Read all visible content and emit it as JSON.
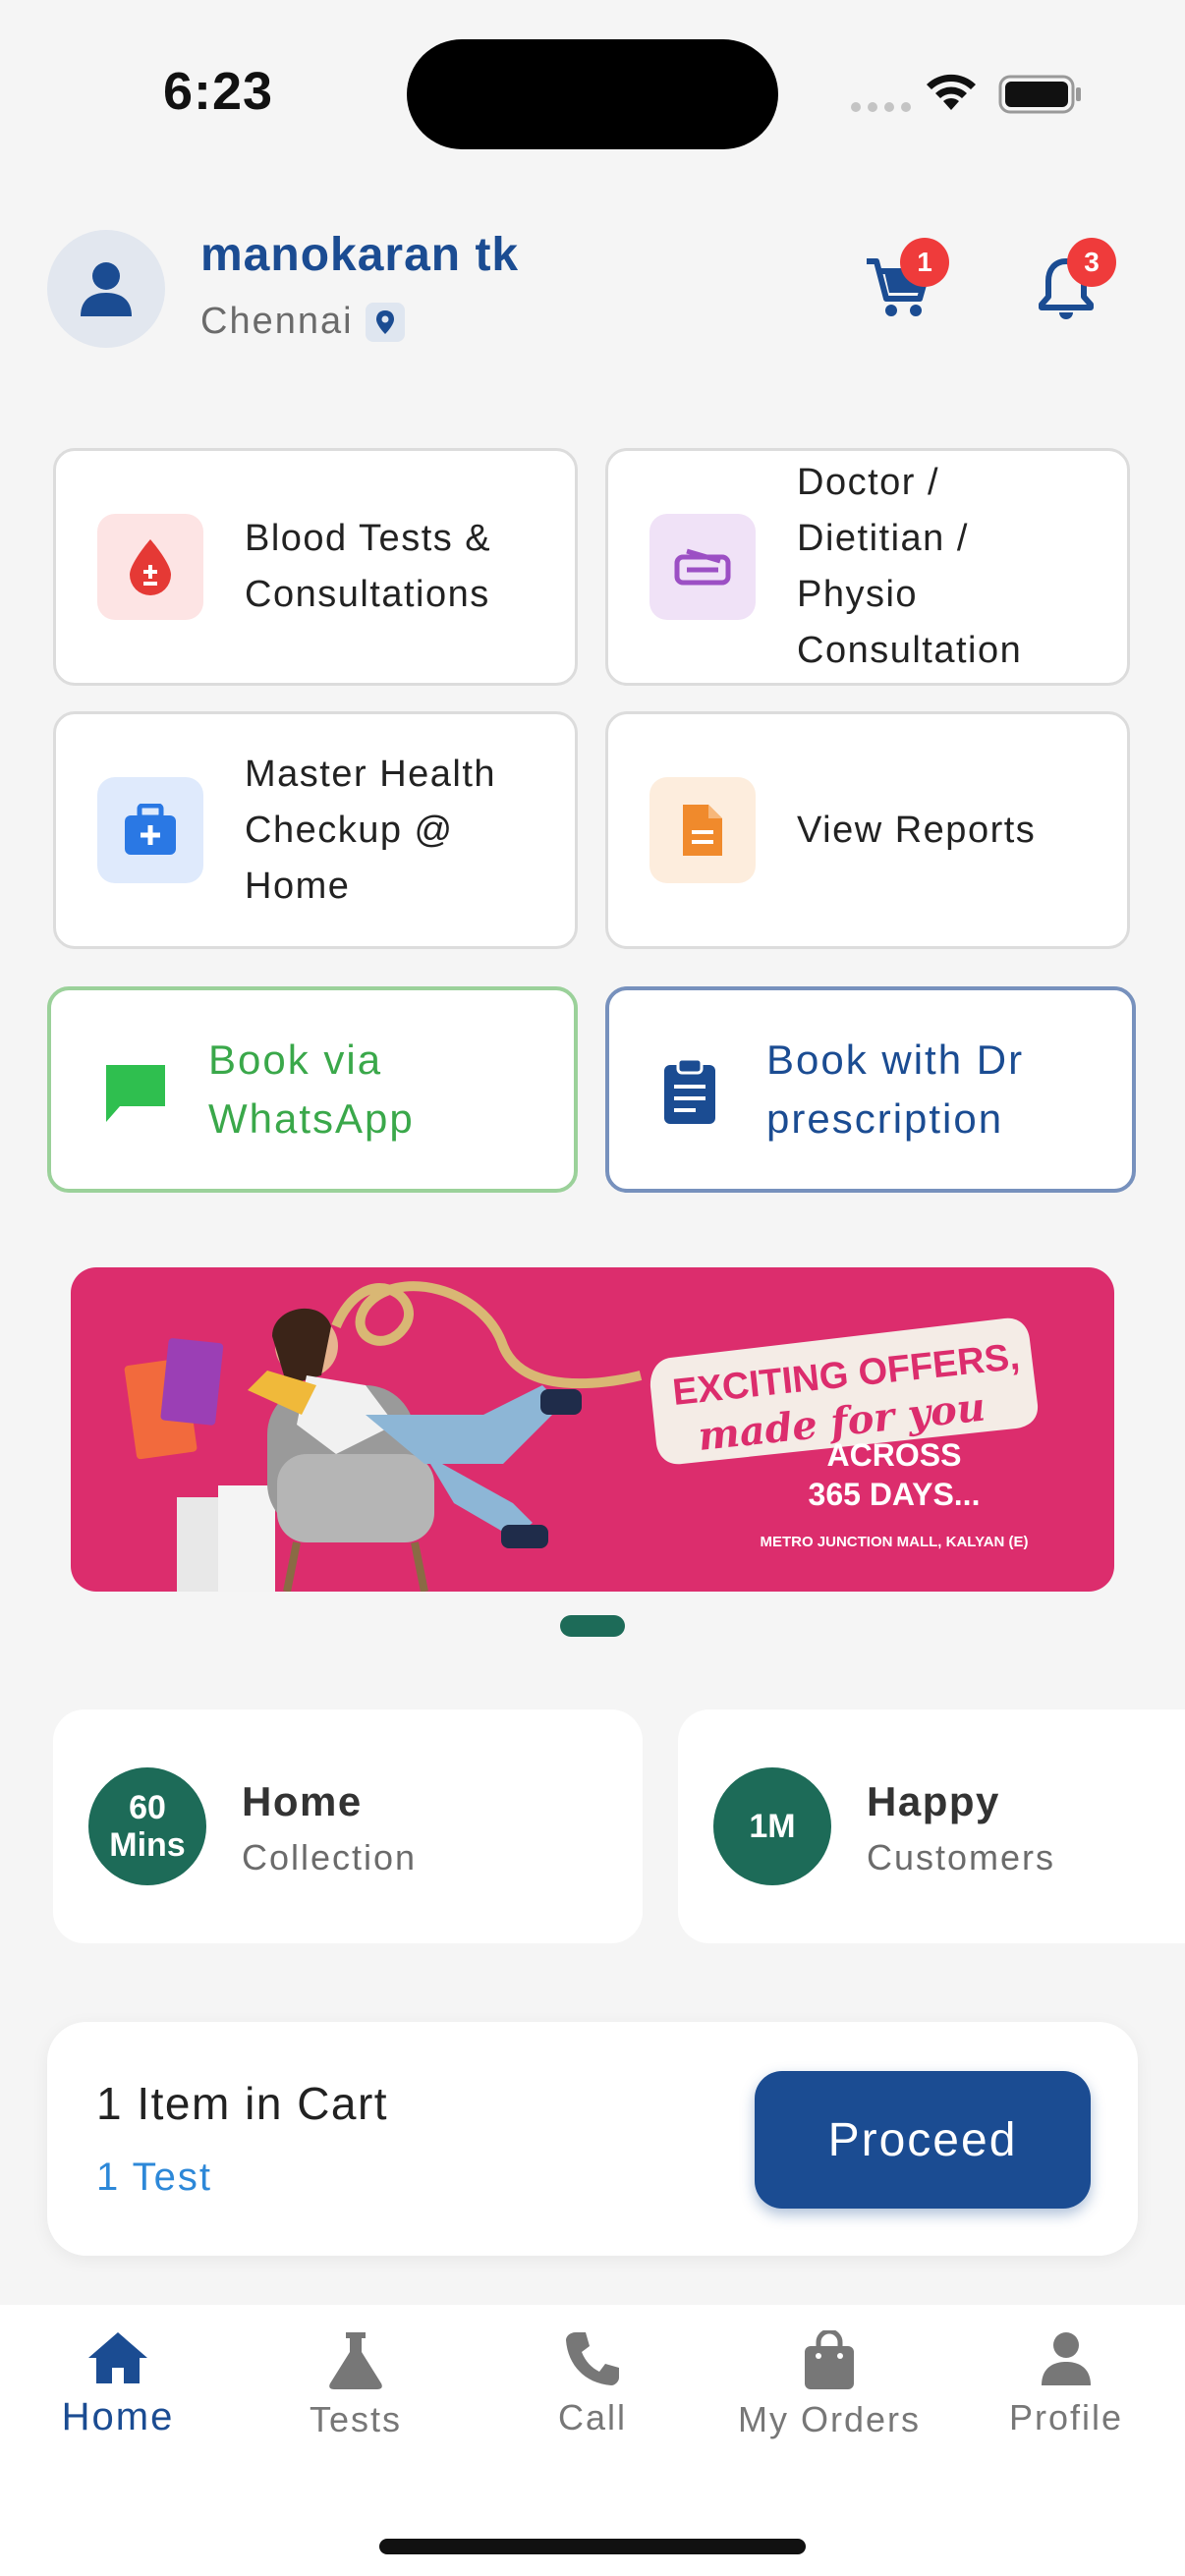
{
  "status_bar": {
    "time": "6:23"
  },
  "header": {
    "user_name": "manokaran tk",
    "city": "Chennai",
    "cart_count": "1",
    "notification_count": "3"
  },
  "services": [
    {
      "label": "Blood Tests &\nConsultations",
      "icon": "blood-drop-icon",
      "color": "#e53935",
      "bg": "#fde4e4"
    },
    {
      "label": "Doctor /\nDietitian /\nPhysio\nConsultation",
      "icon": "stethoscope-icon",
      "color": "#9c4fc4",
      "bg": "#f0e2f7"
    },
    {
      "label": "Master Health\nCheckup @\nHome",
      "icon": "medical-kit-icon",
      "color": "#2a78e4",
      "bg": "#dfeafc"
    },
    {
      "label": "View Reports",
      "icon": "document-icon",
      "color": "#f08a2c",
      "bg": "#fdeddd"
    }
  ],
  "booking": {
    "whatsapp_label": "Book via\nWhatsApp",
    "prescription_label": "Book with Dr\nprescription",
    "whatsapp_color": "#3aa84a",
    "prescription_color": "#1b4c92"
  },
  "banner": {
    "line1": "EXCITING OFFERS,",
    "line2": "made for you",
    "line3": "ACROSS",
    "line4": "365 DAYS...",
    "line5": "METRO JUNCTION MALL, KALYAN (E)"
  },
  "stats": [
    {
      "badge_line1": "60",
      "badge_line2": "Mins",
      "title": "Home",
      "subtitle": "Collection"
    },
    {
      "badge_line1": "1M",
      "badge_line2": "",
      "title": "Happy",
      "subtitle": "Customers"
    }
  ],
  "cart_summary": {
    "title": "1 Item in Cart",
    "subtitle": "1 Test",
    "button": "Proceed"
  },
  "nav": [
    {
      "label": "Home",
      "icon": "home-icon",
      "active": true
    },
    {
      "label": "Tests",
      "icon": "flask-icon",
      "active": false
    },
    {
      "label": "Call",
      "icon": "phone-icon",
      "active": false
    },
    {
      "label": "My Orders",
      "icon": "shopping-bag-icon",
      "active": false
    },
    {
      "label": "Profile",
      "icon": "person-icon",
      "active": false
    }
  ],
  "colors": {
    "primary": "#1b4c92",
    "accent_green": "#1d6b58",
    "banner_pink": "#dc2d6d",
    "badge_red": "#ef3b3b"
  }
}
